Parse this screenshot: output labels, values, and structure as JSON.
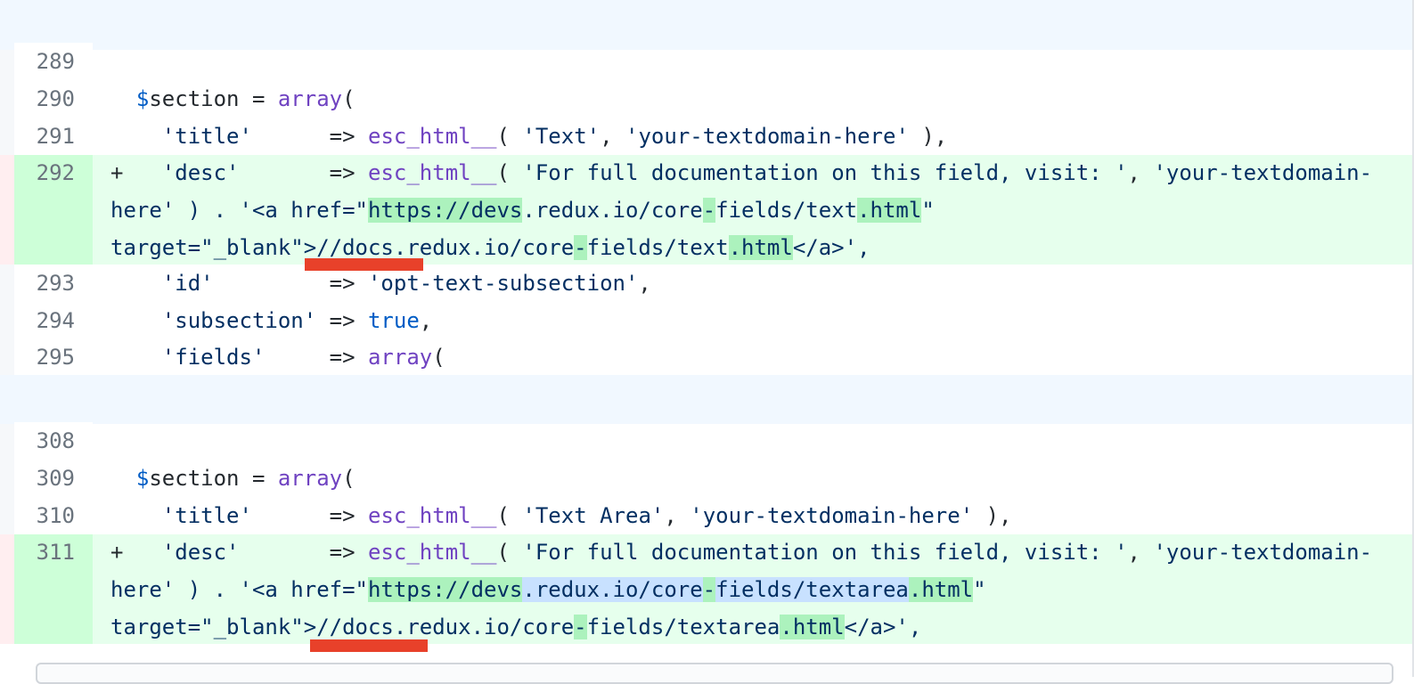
{
  "diff": {
    "block1": [
      {
        "num": "289",
        "code": ""
      },
      {
        "num": "290",
        "code": "  $section = array("
      },
      {
        "num": "291",
        "code": "    'title'      => esc_html__( 'Text', 'your-textdomain-here' ),"
      }
    ],
    "line292": {
      "num": "292",
      "row1": "+   'desc'       => esc_html__( 'For full documentation on this field, visit: ', 'your-textdomain-",
      "row2": "here' ) . '<a href=\"https://devs.redux.io/core-fields/text.html\"",
      "row3": "target=\"_blank\">//docs.redux.io/core-fields/text.html</a>',"
    },
    "block2": [
      {
        "num": "293",
        "code": "    'id'         => 'opt-text-subsection',"
      },
      {
        "num": "294",
        "code": "    'subsection' => true,"
      },
      {
        "num": "295",
        "code": "    'fields'     => array("
      }
    ],
    "block3": [
      {
        "num": "308",
        "code": ""
      },
      {
        "num": "309",
        "code": "  $section = array("
      },
      {
        "num": "310",
        "code": "    'title'      => esc_html__( 'Text Area', 'your-textdomain-here' ),"
      }
    ],
    "line311": {
      "num": "311",
      "row1": "+   'desc'       => esc_html__( 'For full documentation on this field, visit: ', 'your-textdomain-",
      "row2": "here' ) . '<a href=\"https://devs.redux.io/core-fields/textarea.html\"",
      "row3": "target=\"_blank\">//docs.redux.io/core-fields/textarea.html</a>',"
    }
  },
  "colors": {
    "hunk_bg": "#f1f8ff",
    "added_bg": "#e6ffed",
    "added_num_bg": "#cdffd8",
    "word_highlight": "#acf2bd",
    "selection": "#c8e1ff",
    "red_annotation": "#e8412a"
  }
}
